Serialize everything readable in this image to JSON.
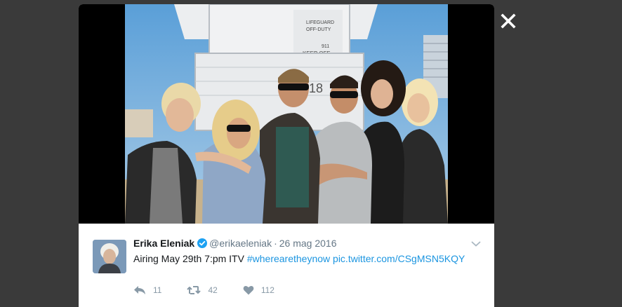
{
  "tweet": {
    "author_name": "Erika Eleniak",
    "handle": "@erikaeleniak",
    "separator": "·",
    "date": "26 mag 2016",
    "text_plain": "Airing May 29th 7:pm ITV ",
    "hashtag": "#wherearetheynow",
    "pic_link": "pic.twitter.com/CSgMSN5KQY",
    "actions": {
      "reply_count": "11",
      "retweet_count": "42",
      "like_count": "112"
    }
  },
  "photo_sign": {
    "line1": "LIFEGUARD",
    "line2": "OFF-DUTY",
    "line3": "911",
    "line4": "KEEP OFF",
    "tower_number": "18"
  },
  "colors": {
    "backdrop": "#3a3a3a",
    "link": "#1b95e0",
    "verified": "#1da1f2",
    "icon_gray": "#8899a6"
  },
  "icons": {
    "close": "close-icon",
    "verified": "verified-badge-icon",
    "chevron": "chevron-down-icon",
    "reply": "reply-icon",
    "retweet": "retweet-icon",
    "like": "heart-icon"
  }
}
